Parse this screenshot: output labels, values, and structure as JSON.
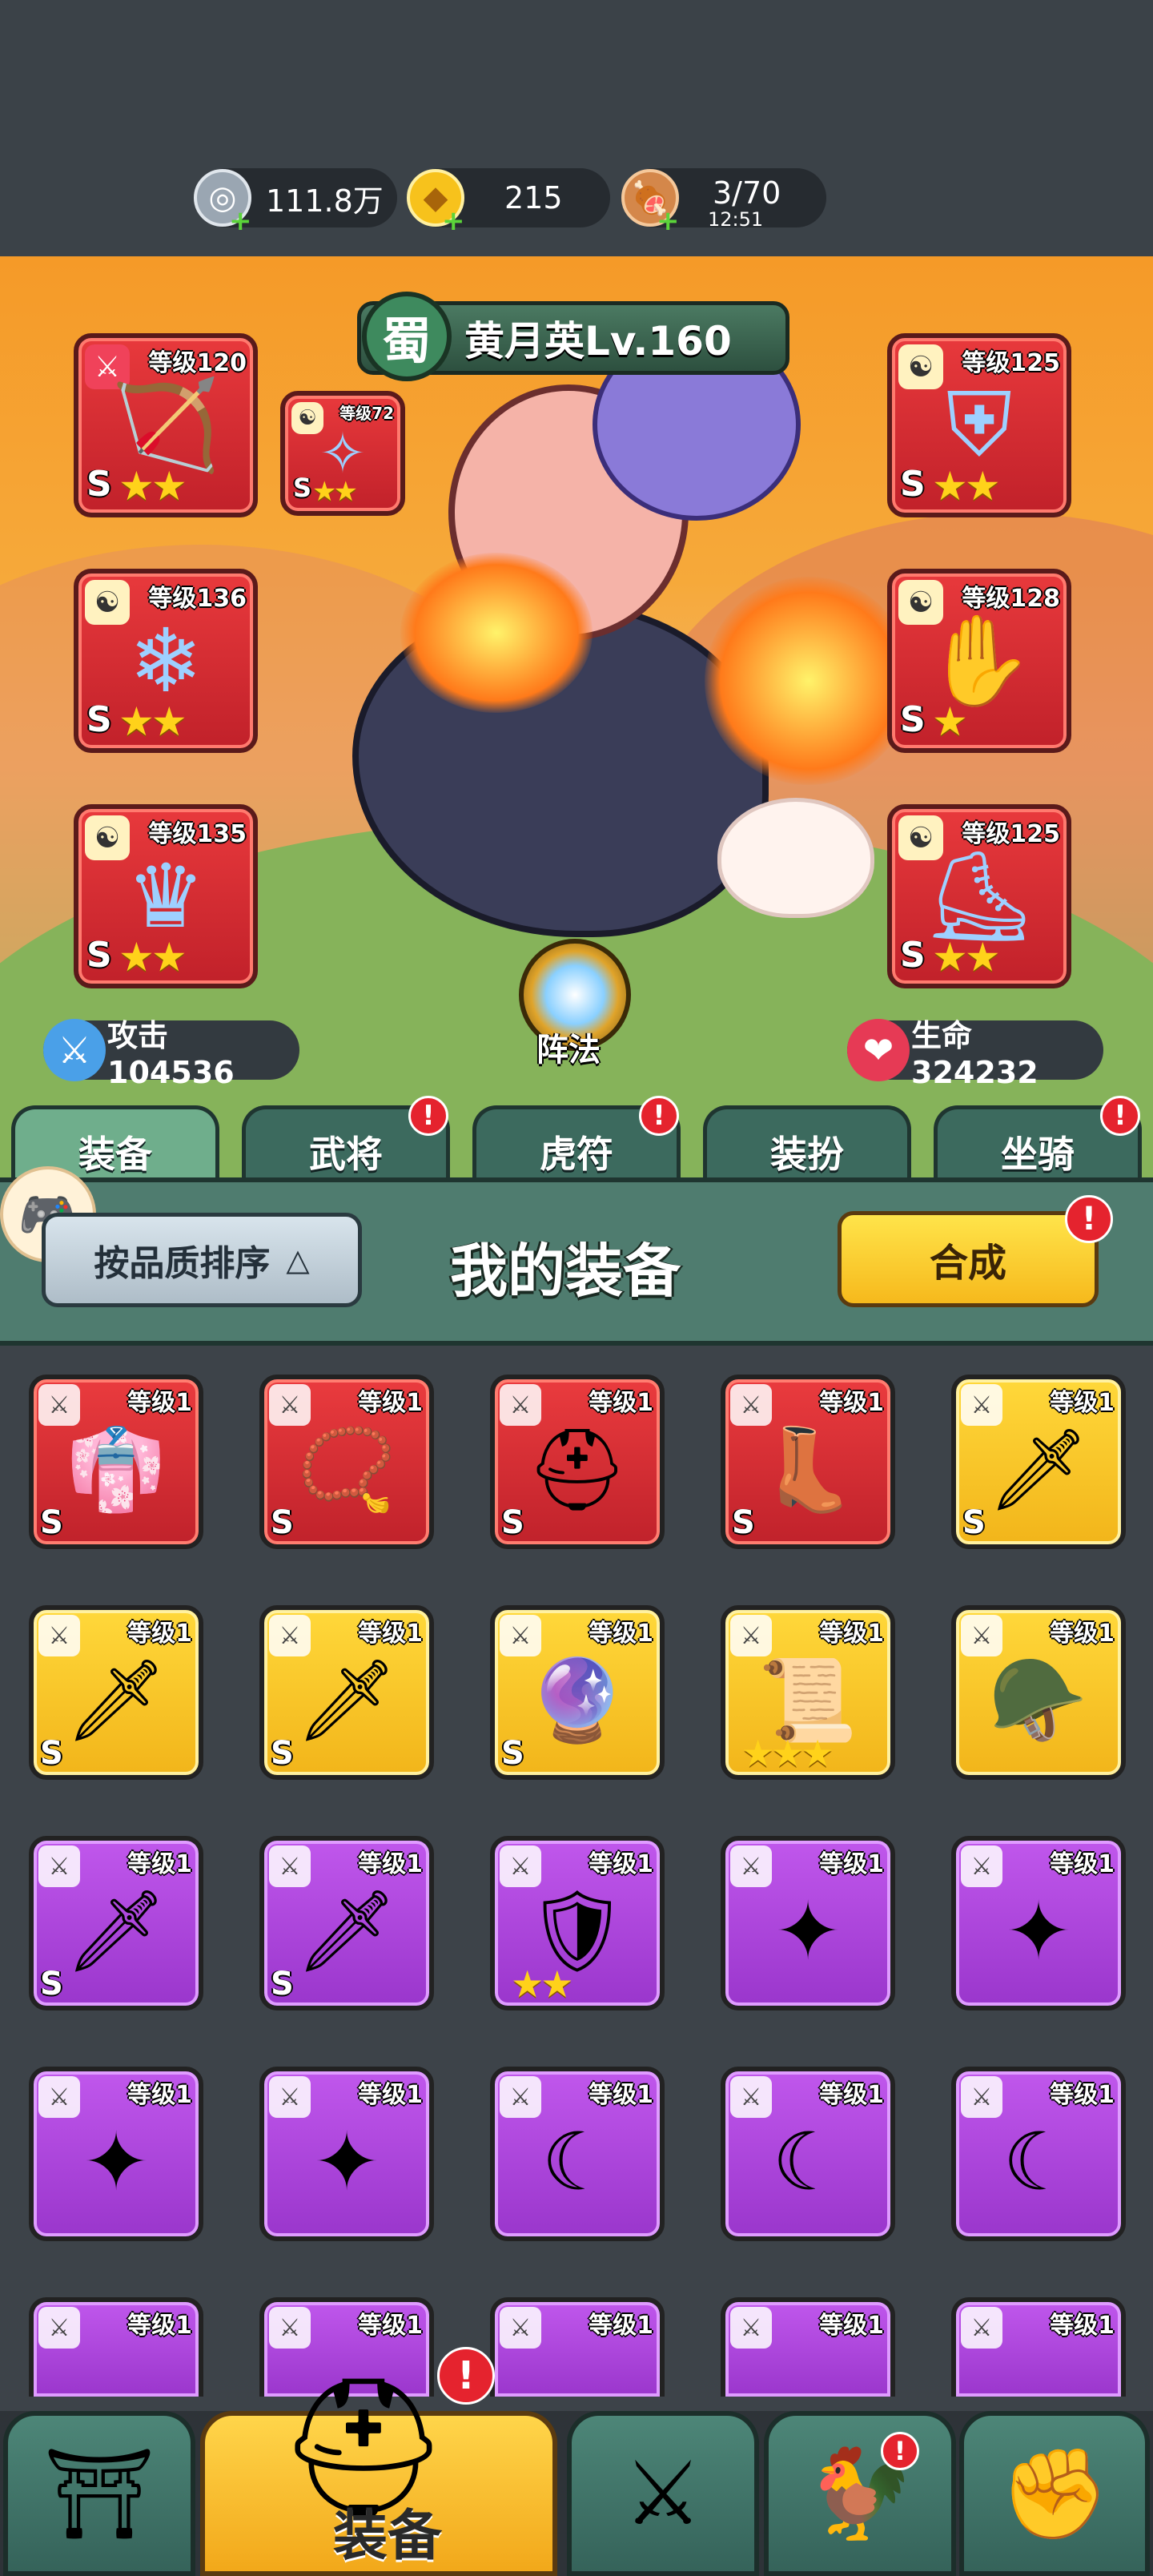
{
  "resources": [
    {
      "icon": "silver-coin-icon",
      "value": "111.8万"
    },
    {
      "icon": "gold-ingot-icon",
      "value": "215"
    },
    {
      "icon": "meat-icon",
      "value": "3/70",
      "sub": "12:51"
    }
  ],
  "hero": {
    "faction": "蜀",
    "name": "黄月英Lv.160",
    "attack_label": "攻击104536",
    "hp_label": "生命324232",
    "formation_label": "阵法"
  },
  "hero_slots": [
    {
      "level": "等级120",
      "quality": "S",
      "stars": 2,
      "tag": "sword-tag-icon"
    },
    {
      "level": "等级72",
      "quality": "S",
      "stars": 2,
      "tag": "yinyang-tag-icon"
    },
    {
      "level": "等级136",
      "quality": "S",
      "stars": 2,
      "tag": "yinyang-tag-icon"
    },
    {
      "level": "等级135",
      "quality": "S",
      "stars": 2,
      "tag": "yinyang-tag-icon"
    },
    {
      "level": "等级125",
      "quality": "S",
      "stars": 2,
      "tag": "yinyang-tag-icon"
    },
    {
      "level": "等级128",
      "quality": "S",
      "stars": 1,
      "tag": "yinyang-tag-icon"
    },
    {
      "level": "等级125",
      "quality": "S",
      "stars": 2,
      "tag": "yinyang-tag-icon"
    }
  ],
  "tabs": [
    {
      "label": "装备",
      "active": true,
      "badge": false
    },
    {
      "label": "武将",
      "active": false,
      "badge": true
    },
    {
      "label": "虎符",
      "active": false,
      "badge": true
    },
    {
      "label": "装扮",
      "active": false,
      "badge": false
    },
    {
      "label": "坐骑",
      "active": false,
      "badge": true
    }
  ],
  "panel": {
    "sort_label": "按品质排序",
    "title": "我的装备",
    "synth_label": "合成"
  },
  "badge_mark": "!",
  "equipment": [
    {
      "color": "red",
      "level": "等级1",
      "quality": "S",
      "stars": 0,
      "art": "👘"
    },
    {
      "color": "red",
      "level": "等级1",
      "quality": "S",
      "stars": 0,
      "art": "📿"
    },
    {
      "color": "red",
      "level": "等级1",
      "quality": "S",
      "stars": 0,
      "art": "⛑"
    },
    {
      "color": "red",
      "level": "等级1",
      "quality": "S",
      "stars": 0,
      "art": "👢"
    },
    {
      "color": "yellow",
      "level": "等级1",
      "quality": "S",
      "stars": 0,
      "art": "🗡"
    },
    {
      "color": "yellow",
      "level": "等级1",
      "quality": "S",
      "stars": 0,
      "art": "🗡"
    },
    {
      "color": "yellow",
      "level": "等级1",
      "quality": "S",
      "stars": 0,
      "art": "🗡"
    },
    {
      "color": "yellow",
      "level": "等级1",
      "quality": "S",
      "stars": 0,
      "art": "🔮"
    },
    {
      "color": "yellow",
      "level": "等级1",
      "quality": "",
      "stars": 3,
      "art": "📜"
    },
    {
      "color": "yellow",
      "level": "等级1",
      "quality": "",
      "stars": 0,
      "art": "🪖"
    },
    {
      "color": "purple",
      "level": "等级1",
      "quality": "S",
      "stars": 0,
      "art": "🗡"
    },
    {
      "color": "purple",
      "level": "等级1",
      "quality": "S",
      "stars": 0,
      "art": "🗡"
    },
    {
      "color": "purple",
      "level": "等级1",
      "quality": "",
      "stars": 2,
      "art": "🛡"
    },
    {
      "color": "purple",
      "level": "等级1",
      "quality": "",
      "stars": 0,
      "art": "✦"
    },
    {
      "color": "purple",
      "level": "等级1",
      "quality": "",
      "stars": 0,
      "art": "✦"
    },
    {
      "color": "purple",
      "level": "等级1",
      "quality": "",
      "stars": 0,
      "art": "✦"
    },
    {
      "color": "purple",
      "level": "等级1",
      "quality": "",
      "stars": 0,
      "art": "✦"
    },
    {
      "color": "purple",
      "level": "等级1",
      "quality": "",
      "stars": 0,
      "art": "☾"
    },
    {
      "color": "purple",
      "level": "等级1",
      "quality": "",
      "stars": 0,
      "art": "☾"
    },
    {
      "color": "purple",
      "level": "等级1",
      "quality": "",
      "stars": 0,
      "art": "☾"
    },
    {
      "color": "purple",
      "level": "等级1",
      "quality": "",
      "stars": 0,
      "art": ""
    },
    {
      "color": "purple",
      "level": "等级1",
      "quality": "",
      "stars": 0,
      "art": ""
    },
    {
      "color": "purple",
      "level": "等级1",
      "quality": "",
      "stars": 0,
      "art": ""
    },
    {
      "color": "purple",
      "level": "等级1",
      "quality": "",
      "stars": 0,
      "art": ""
    },
    {
      "color": "purple",
      "level": "等级1",
      "quality": "",
      "stars": 0,
      "art": ""
    }
  ],
  "bottom_nav": [
    {
      "icon": "gate-icon",
      "label": "",
      "active": false
    },
    {
      "icon": "helmet-icon",
      "label": "装备",
      "active": true
    },
    {
      "icon": "swords-icon",
      "label": "",
      "active": false
    },
    {
      "icon": "rooster-icon",
      "label": "",
      "active": false,
      "badge": true
    },
    {
      "icon": "fist-upgrade-icon",
      "label": "",
      "active": false
    }
  ]
}
